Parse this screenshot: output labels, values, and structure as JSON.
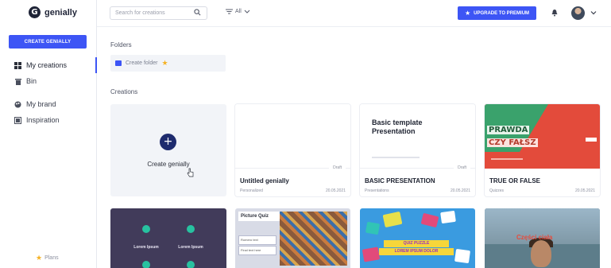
{
  "app": {
    "name": "genially",
    "logo_letter": "G"
  },
  "sidebar": {
    "create_button": "CREATE GENIALLY",
    "items": [
      {
        "label": "My creations",
        "icon": "grid-icon",
        "active": true
      },
      {
        "label": "Bin",
        "icon": "trash-icon",
        "active": false
      },
      {
        "label": "My brand",
        "icon": "palette-icon",
        "active": false
      },
      {
        "label": "Inspiration",
        "icon": "gallery-icon",
        "active": false
      }
    ],
    "plans_label": "Plans"
  },
  "topbar": {
    "search_placeholder": "Search for creations",
    "filter_label": "All",
    "upgrade_button": "UPGRADE TO PREMIUM"
  },
  "main": {
    "folders_title": "Folders",
    "create_folder": "Create folder",
    "creations_title": "Creations",
    "create_card_label": "Create genially",
    "cards": [
      {
        "title": "Untitled genially",
        "status": "Draft",
        "meta": "Personalized",
        "date": "20.05.2021"
      },
      {
        "title": "BASIC PRESENTATION",
        "status": "Draft",
        "meta": "Presentations",
        "date": "20.05.2021",
        "thumb_title": "Basic template Presentation"
      },
      {
        "title": "TRUE OR FALSE",
        "meta": "Quizzes",
        "date": "20.05.2021",
        "thumb_line1": "PRAWDA",
        "thumb_line2": "CZY FAŁSZ"
      }
    ],
    "bottom_cards": [
      {
        "lorem_left": "Lorem Ipsum",
        "lorem_right": "Lorem Ipsum"
      },
      {
        "thumb_title": "Picture Quiz",
        "box1": "Romero text",
        "box2": "Final text here"
      },
      {
        "banner1": "QUIZ PUZZLE",
        "banner2": "LOREM IPSUM DOLOR"
      },
      {
        "thumb_title": "Części ciała"
      }
    ]
  },
  "colors": {
    "accent": "#3d55f5",
    "star": "#f5b225",
    "sidebar_active": "#3d55f5"
  }
}
